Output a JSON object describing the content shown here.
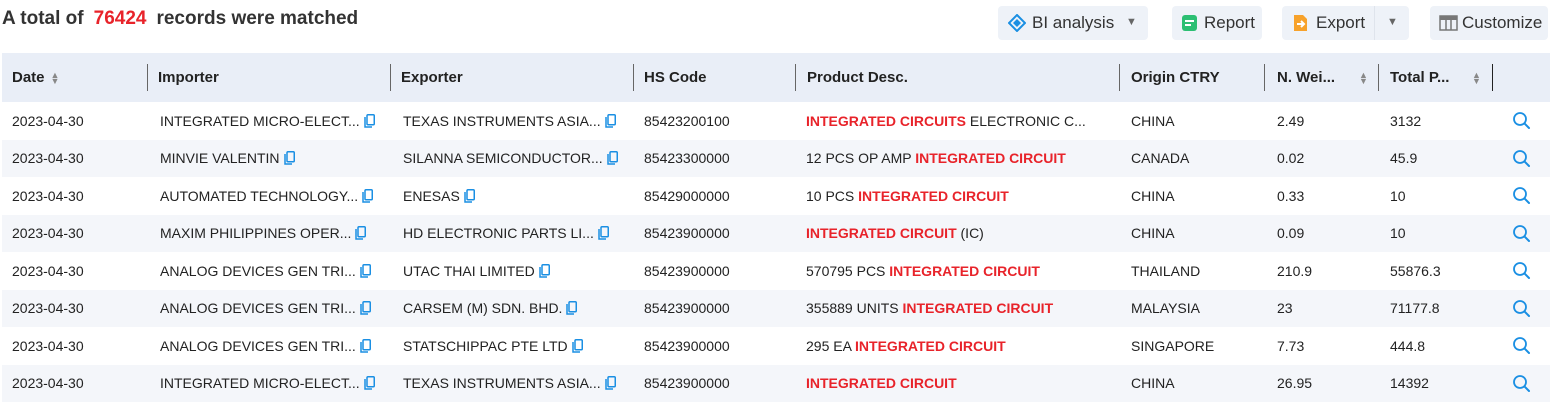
{
  "summary": {
    "prefix": "A total of",
    "count": "76424",
    "suffix": "records were matched"
  },
  "toolbar": {
    "bi_label": "BI analysis",
    "report_label": "Report",
    "export_label": "Export",
    "customize_label": "Customize"
  },
  "colors": {
    "accent": "#e8232a",
    "header_bg": "#e9eef7",
    "link_blue": "#1a8fe3"
  },
  "columns": [
    "Date",
    "Importer",
    "Exporter",
    "HS Code",
    "Product Desc.",
    "Origin CTRY",
    "N. Wei...",
    "Total P..."
  ],
  "rows": [
    {
      "date": "2023-04-30",
      "importer": "INTEGRATED MICRO-ELECT...",
      "exporter": "TEXAS INSTRUMENTS ASIA...",
      "hs": "85423200100",
      "desc_pre": "",
      "desc_hl": "INTEGRATED CIRCUITS",
      "desc_post": " ELECTRONIC C...",
      "origin": "CHINA",
      "weight": "2.49",
      "total": "3132"
    },
    {
      "date": "2023-04-30",
      "importer": "MINVIE VALENTIN",
      "exporter": "SILANNA SEMICONDUCTOR...",
      "hs": "85423300000",
      "desc_pre": "12 PCS OP AMP ",
      "desc_hl": "INTEGRATED CIRCUIT",
      "desc_post": "",
      "origin": "CANADA",
      "weight": "0.02",
      "total": "45.9"
    },
    {
      "date": "2023-04-30",
      "importer": "AUTOMATED TECHNOLOGY...",
      "exporter": "ENESAS",
      "hs": "85429000000",
      "desc_pre": "10 PCS ",
      "desc_hl": "INTEGRATED CIRCUIT",
      "desc_post": "",
      "origin": "CHINA",
      "weight": "0.33",
      "total": "10"
    },
    {
      "date": "2023-04-30",
      "importer": "MAXIM PHILIPPINES OPER...",
      "exporter": "HD ELECTRONIC PARTS LI...",
      "hs": "85423900000",
      "desc_pre": "",
      "desc_hl": "INTEGRATED CIRCUIT",
      "desc_post": " (IC)",
      "origin": "CHINA",
      "weight": "0.09",
      "total": "10"
    },
    {
      "date": "2023-04-30",
      "importer": "ANALOG DEVICES GEN TRI...",
      "exporter": "UTAC THAI LIMITED",
      "hs": "85423900000",
      "desc_pre": "570795 PCS ",
      "desc_hl": "INTEGRATED CIRCUIT",
      "desc_post": "",
      "origin": "THAILAND",
      "weight": "210.9",
      "total": "55876.3"
    },
    {
      "date": "2023-04-30",
      "importer": "ANALOG DEVICES GEN TRI...",
      "exporter": "CARSEM (M) SDN. BHD.",
      "hs": "85423900000",
      "desc_pre": "355889 UNITS ",
      "desc_hl": "INTEGRATED CIRCUIT",
      "desc_post": "",
      "origin": "MALAYSIA",
      "weight": "23",
      "total": "71177.8"
    },
    {
      "date": "2023-04-30",
      "importer": "ANALOG DEVICES GEN TRI...",
      "exporter": "STATSCHIPPAC PTE LTD",
      "hs": "85423900000",
      "desc_pre": "295 EA ",
      "desc_hl": "INTEGRATED CIRCUIT",
      "desc_post": "",
      "origin": "SINGAPORE",
      "weight": "7.73",
      "total": "444.8"
    },
    {
      "date": "2023-04-30",
      "importer": "INTEGRATED MICRO-ELECT...",
      "exporter": "TEXAS INSTRUMENTS ASIA...",
      "hs": "85423900000",
      "desc_pre": "",
      "desc_hl": "INTEGRATED CIRCUIT",
      "desc_post": "",
      "origin": "CHINA",
      "weight": "26.95",
      "total": "14392"
    }
  ]
}
